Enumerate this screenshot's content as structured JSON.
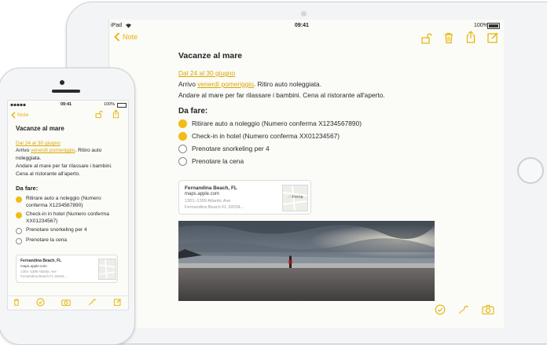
{
  "ipad": {
    "status": {
      "device": "iPad",
      "time": "09:41",
      "battery": "100%"
    },
    "nav": {
      "back_label": "Note"
    },
    "note": {
      "title": "Vacanze al mare",
      "date_link": "Dal 24 al 30 giugno",
      "line1_prefix": "Arrivo ",
      "line1_link": "venerdì pomeriggio",
      "line1_suffix": ". Ritiro auto noleggiata.",
      "line2": "Andare al mare per far rilassare i bambini. Cena al ristorante all'aperto.",
      "todo_heading": "Da fare:",
      "todos": [
        {
          "label": "Ritirare auto a noleggio (Numero conferma X1234567890)",
          "done": true
        },
        {
          "label": "Check-in in hotel (Numero conferma XX01234567)",
          "done": true
        },
        {
          "label": "Prenotare snorkeling per 4",
          "done": false
        },
        {
          "label": "Prenotare la cena",
          "done": false
        }
      ],
      "map_card": {
        "title": "Fernandina Beach, FL",
        "url": "maps.apple.com",
        "address1": "1301–1399 Atlantic Ave",
        "address2": "Fernandina Beach FL 32034...",
        "map_label": "Ferna"
      }
    }
  },
  "iphone": {
    "status": {
      "time": "09:41",
      "battery": "100%"
    },
    "nav": {
      "back_label": "Note"
    },
    "note": {
      "title": "Vacanze al mare",
      "date_link": "Dal 24 al 30 giugno",
      "line1_prefix": "Arrivo ",
      "line1_link": "venerdì pomeriggio",
      "line1_suffix": ". Ritiro auto",
      "line1b": "noleggiata.",
      "line2": "Andare al mare per far rilassare i bambini.",
      "line3": "Cena al ristorante all'aperto.",
      "todo_heading": "Da fare:",
      "todos": [
        {
          "label1": "Ritirare auto a noleggio (Numero",
          "label2": "conferma X1234567890)",
          "done": true
        },
        {
          "label1": "Check-in in hotel (Numero conferma",
          "label2": "XX01234567)",
          "done": true
        },
        {
          "label1": "Prenotare snorkeling per 4",
          "label2": "",
          "done": false
        },
        {
          "label1": "Prenotare la cena",
          "label2": "",
          "done": false
        }
      ],
      "map_card": {
        "title": "Fernandina Beach, FL",
        "url": "maps.apple.com",
        "address1": "1301–1399 Atlantic Ave",
        "address2": "Fernandina Beach FL 32034..."
      }
    }
  },
  "colors": {
    "accent": "#e6b400",
    "check": "#f2bc16"
  }
}
